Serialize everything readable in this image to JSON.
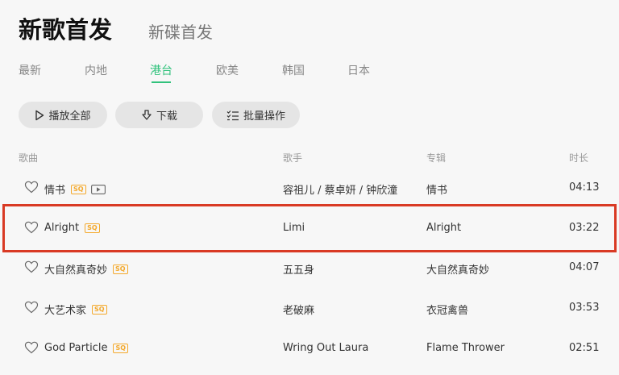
{
  "header": {
    "title": "新歌首发",
    "subtitle": "新碟首发"
  },
  "tabs": [
    {
      "label": "最新",
      "active": false
    },
    {
      "label": "内地",
      "active": false
    },
    {
      "label": "港台",
      "active": true
    },
    {
      "label": "欧美",
      "active": false
    },
    {
      "label": "韩国",
      "active": false
    },
    {
      "label": "日本",
      "active": false
    }
  ],
  "actions": {
    "play_all": "播放全部",
    "download": "下载",
    "batch": "批量操作"
  },
  "columns": {
    "song": "歌曲",
    "singer": "歌手",
    "album": "专辑",
    "duration": "时长"
  },
  "quality_badge": "SQ",
  "songs": [
    {
      "title": "情书",
      "singer": "容祖儿 / 蔡卓妍 / 钟欣潼",
      "album": "情书",
      "duration": "04:13",
      "has_mv": true
    },
    {
      "title": "Alright",
      "singer": "Limi",
      "album": "Alright",
      "duration": "03:22",
      "has_mv": false,
      "highlighted": true
    },
    {
      "title": "大自然真奇妙",
      "singer": "五五身",
      "album": "大自然真奇妙",
      "duration": "04:07",
      "has_mv": false
    },
    {
      "title": "大艺术家",
      "singer": "老破麻",
      "album": "衣冠禽兽",
      "duration": "03:53",
      "has_mv": false
    },
    {
      "title": "God Particle",
      "singer": "Wring Out Laura",
      "album": "Flame Thrower",
      "duration": "02:51",
      "has_mv": false
    }
  ],
  "colors": {
    "accent": "#31c27c",
    "highlight_border": "#d93a24",
    "sq_badge": "#f4a92c"
  },
  "icons": {
    "play": "play-icon",
    "download": "download-icon",
    "batch": "list-check-icon",
    "favorite": "heart-icon",
    "mv": "mv-icon"
  }
}
